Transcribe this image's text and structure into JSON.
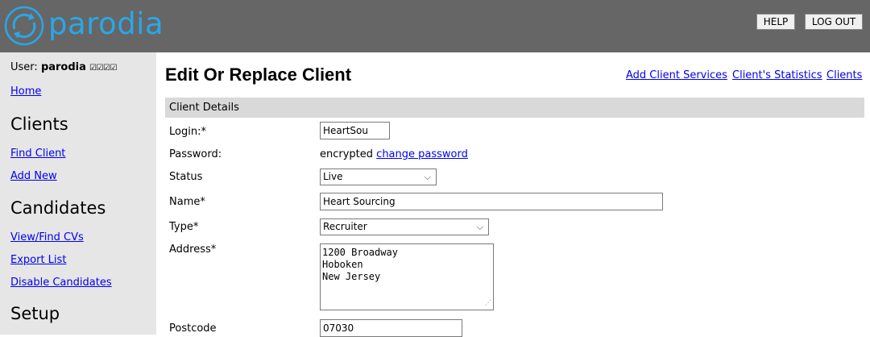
{
  "header": {
    "logo_text": "parodia",
    "help_label": "HELP",
    "logout_label": "LOG OUT"
  },
  "sidebar": {
    "user_prefix": "User:",
    "user_name": "parodia",
    "user_checks": "☑☑☑☑",
    "home": "Home",
    "clients_heading": "Clients",
    "find_client": "Find Client",
    "add_new": "Add New",
    "candidates_heading": "Candidates",
    "view_find_cvs": "View/Find CVs",
    "export_list": "Export List",
    "disable_candidates": "Disable Candidates",
    "setup_heading": "Setup"
  },
  "main": {
    "title": "Edit Or Replace Client",
    "top_links": {
      "add_client_services": "Add Client Services",
      "client_statistics": "Client's Statistics",
      "clients": "Clients"
    },
    "section_title": "Client Details",
    "fields": {
      "login_label": "Login:*",
      "login_value": "HeartSou",
      "password_label": "Password:",
      "password_text": "encrypted",
      "change_password": "change password",
      "status_label": "Status",
      "status_value": "Live",
      "name_label": "Name*",
      "name_value": "Heart Sourcing",
      "type_label": "Type*",
      "type_value": "Recruiter",
      "address_label": "Address*",
      "address_value": "1200 Broadway\nHoboken\nNew Jersey",
      "postcode_label": "Postcode",
      "postcode_value": "07030"
    }
  },
  "colors": {
    "header_bg": "#666666",
    "logo": "#2aa7e6",
    "sidebar_bg": "#e6e6e6",
    "section_bg": "#d9d9d9",
    "link": "#0000ee"
  }
}
